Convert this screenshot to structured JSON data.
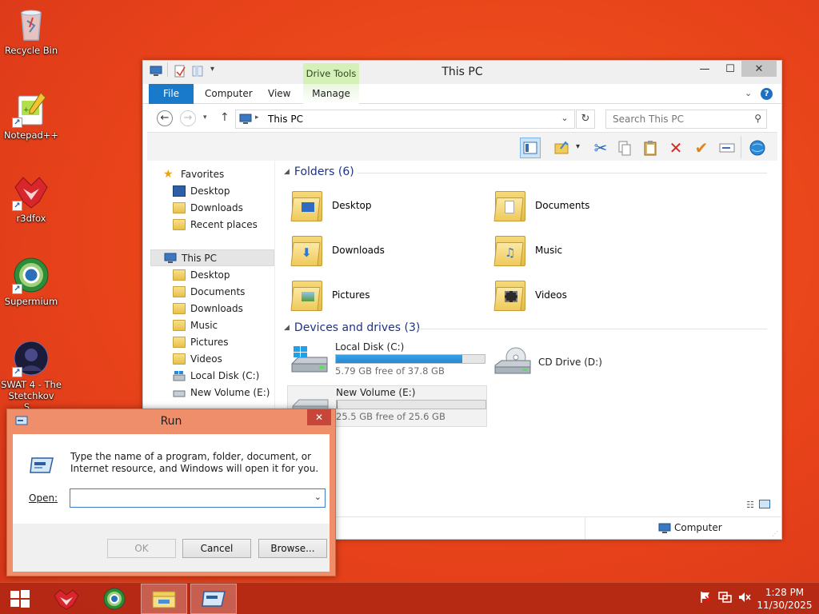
{
  "desktop": {
    "icons": [
      {
        "label": "Recycle Bin",
        "icon": "recycle-bin-icon"
      },
      {
        "label": "Notepad++",
        "icon": "notepadpp-icon"
      },
      {
        "label": "r3dfox",
        "icon": "r3dfox-icon"
      },
      {
        "label": "Supermium",
        "icon": "supermium-icon"
      },
      {
        "label": "SWAT 4 - The Stetchkov S...",
        "icon": "swat4-icon"
      }
    ]
  },
  "explorer": {
    "title": "This PC",
    "contextual_tab_group": "Drive Tools",
    "tabs": {
      "file": "File",
      "computer": "Computer",
      "view": "View",
      "manage": "Manage"
    },
    "address": {
      "path": "This PC"
    },
    "search": {
      "placeholder": "Search This PC"
    },
    "nav": {
      "favorites": "Favorites",
      "fav_items": [
        "Desktop",
        "Downloads",
        "Recent places"
      ],
      "this_pc": "This PC",
      "pc_items": [
        "Desktop",
        "Documents",
        "Downloads",
        "Music",
        "Pictures",
        "Videos",
        "Local Disk (C:)",
        "New Volume (E:)"
      ]
    },
    "folders_header": "Folders (6)",
    "folders": [
      "Desktop",
      "Documents",
      "Downloads",
      "Music",
      "Pictures",
      "Videos"
    ],
    "devices_header": "Devices and drives (3)",
    "drives": [
      {
        "name": "Local Disk (C:)",
        "free": "5.79 GB free of 37.8 GB",
        "used_fraction": 0.847
      },
      {
        "name": "New Volume (E:)",
        "free": "25.5 GB free of 25.6 GB",
        "used_fraction": 0.004
      },
      {
        "name": "CD Drive (D:)"
      }
    ],
    "status": {
      "location": "Computer"
    }
  },
  "run": {
    "title": "Run",
    "description": "Type the name of a program, folder, document, or Internet resource, and Windows will open it for you.",
    "open_label": "Open:",
    "open_value": "",
    "ok": "OK",
    "cancel": "Cancel",
    "browse": "Browse..."
  },
  "taskbar": {
    "time": "1:28 PM",
    "date": "11/30/2025"
  }
}
